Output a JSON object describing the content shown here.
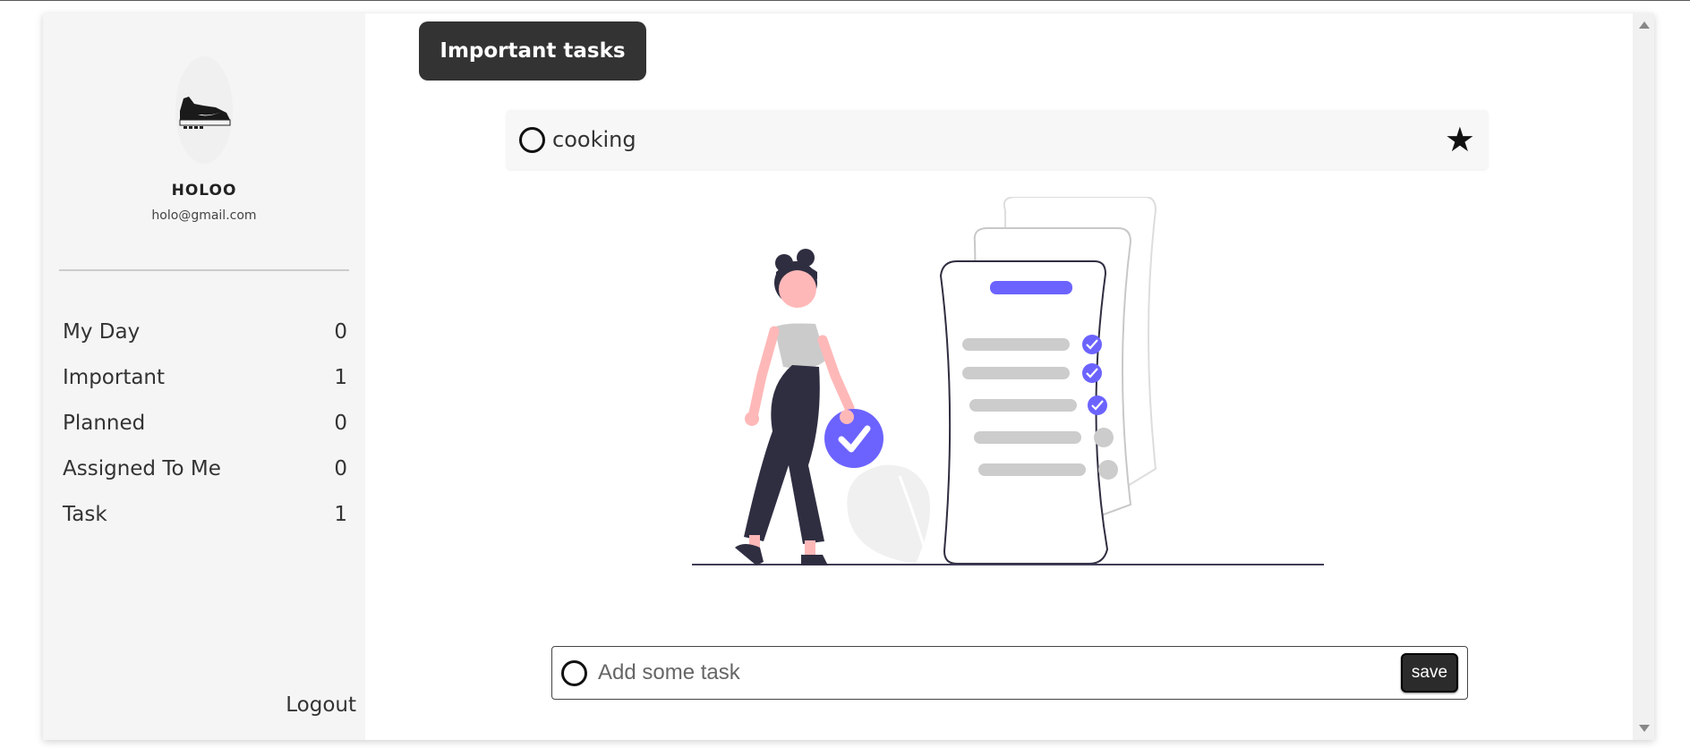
{
  "user": {
    "name": "HOLOO",
    "email": "holo@gmail.com"
  },
  "sidebar": {
    "items": [
      {
        "label": "My Day",
        "count": "0"
      },
      {
        "label": "Important",
        "count": "1"
      },
      {
        "label": "Planned",
        "count": "0"
      },
      {
        "label": "Assigned To Me",
        "count": "0"
      },
      {
        "label": "Task",
        "count": "1"
      }
    ],
    "logout_label": "Logout"
  },
  "main": {
    "header": "Important tasks",
    "tasks": [
      {
        "text": "cooking",
        "important": true,
        "completed": false
      }
    ]
  },
  "add_task": {
    "placeholder": "Add some task",
    "save_label": "save"
  },
  "colors": {
    "accent": "#6c63ff",
    "dark": "#333333",
    "sidebar_bg": "#f5f5f5"
  }
}
